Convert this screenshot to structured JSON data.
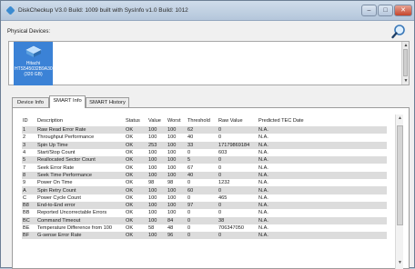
{
  "window": {
    "title": "DiskCheckup V3.0 Build: 1009 built with SysInfo v1.0 Build: 1012",
    "minimize_glyph": "–",
    "maximize_glyph": "□",
    "close_glyph": "✕"
  },
  "devices": {
    "label": "Physical Devices:",
    "items": [
      {
        "name": "Hitachi HTS545032B9A300 (320 GB)"
      }
    ]
  },
  "tabs": [
    {
      "label": "Device Info",
      "active": false
    },
    {
      "label": "SMART Info",
      "active": true
    },
    {
      "label": "SMART History",
      "active": false
    }
  ],
  "table": {
    "headers": [
      "ID",
      "Description",
      "Status",
      "Value",
      "Worst",
      "Threshold",
      "Raw Value",
      "Predicted TEC Date"
    ],
    "rows": [
      [
        "1",
        "Raw Read Error Rate",
        "OK",
        "100",
        "100",
        "62",
        "0",
        "N.A."
      ],
      [
        "2",
        "Throughput Performance",
        "OK",
        "100",
        "100",
        "40",
        "0",
        "N.A."
      ],
      [
        "3",
        "Spin Up Time",
        "OK",
        "253",
        "100",
        "33",
        "17179869184",
        "N.A."
      ],
      [
        "4",
        "Start/Stop Count",
        "OK",
        "100",
        "100",
        "0",
        "603",
        "N.A."
      ],
      [
        "5",
        "Reallocated Sector Count",
        "OK",
        "100",
        "100",
        "5",
        "0",
        "N.A."
      ],
      [
        "7",
        "Seek Error Rate",
        "OK",
        "100",
        "100",
        "67",
        "0",
        "N.A."
      ],
      [
        "8",
        "Seek Time Performance",
        "OK",
        "100",
        "100",
        "40",
        "0",
        "N.A."
      ],
      [
        "9",
        "Power On Time",
        "OK",
        "98",
        "98",
        "0",
        "1232",
        "N.A."
      ],
      [
        "A",
        "Spin Retry Count",
        "OK",
        "100",
        "100",
        "60",
        "0",
        "N.A."
      ],
      [
        "C",
        "Power Cycle Count",
        "OK",
        "100",
        "100",
        "0",
        "465",
        "N.A."
      ],
      [
        "B8",
        "End-to-End error",
        "OK",
        "100",
        "100",
        "97",
        "0",
        "N.A."
      ],
      [
        "BB",
        "Reported Uncorrectable Errors",
        "OK",
        "100",
        "100",
        "0",
        "0",
        "N.A."
      ],
      [
        "BC",
        "Command Timeout",
        "OK",
        "100",
        "84",
        "0",
        "38",
        "N.A."
      ],
      [
        "BE",
        "Temperature Difference from 100",
        "OK",
        "58",
        "48",
        "0",
        "706347050",
        "N.A."
      ],
      [
        "BF",
        "G-sense Error Rate",
        "OK",
        "100",
        "96",
        "0",
        "0",
        "N.A."
      ]
    ]
  }
}
